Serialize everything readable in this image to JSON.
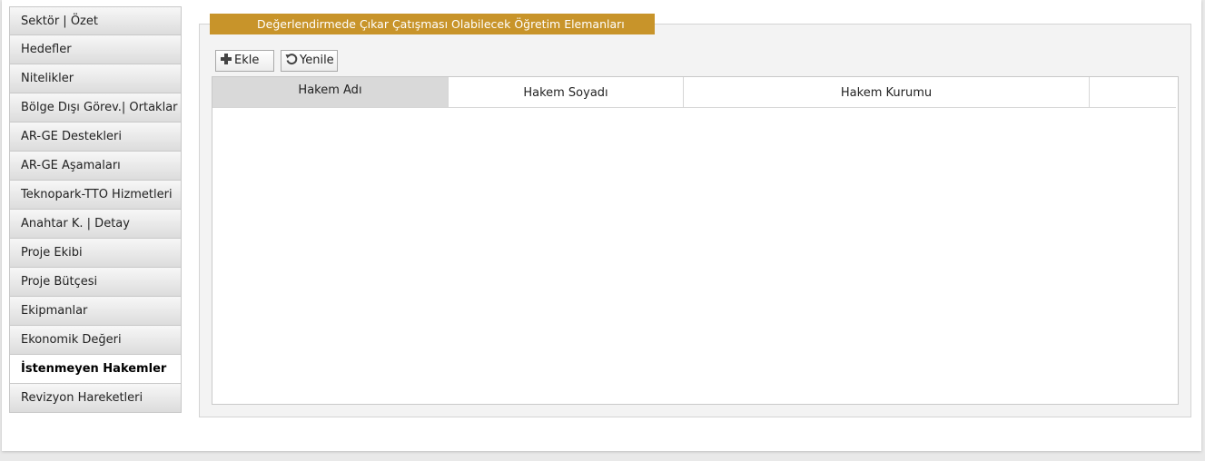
{
  "sidebar": {
    "items": [
      {
        "label": "Sektör | Özet",
        "active": false
      },
      {
        "label": "Hedefler",
        "active": false
      },
      {
        "label": "Nitelikler",
        "active": false
      },
      {
        "label": "Bölge Dışı Görev.| Ortaklar",
        "active": false
      },
      {
        "label": "AR-GE Destekleri",
        "active": false
      },
      {
        "label": "AR-GE Aşamaları",
        "active": false
      },
      {
        "label": "Teknopark-TTO Hizmetleri",
        "active": false
      },
      {
        "label": "Anahtar K. | Detay",
        "active": false
      },
      {
        "label": "Proje Ekibi",
        "active": false
      },
      {
        "label": "Proje Bütçesi",
        "active": false
      },
      {
        "label": "Ekipmanlar",
        "active": false
      },
      {
        "label": "Ekonomik Değeri",
        "active": false
      },
      {
        "label": "İstenmeyen Hakemler",
        "active": true
      },
      {
        "label": "Revizyon Hareketleri",
        "active": false
      }
    ]
  },
  "panel": {
    "title": "Değerlendirmede Çıkar Çatışması Olabilecek Öğretim Elemanları",
    "accent_color": "#c8942a"
  },
  "toolbar": {
    "add_label": "Ekle",
    "add_icon": "plus-icon",
    "refresh_label": "Yenile",
    "refresh_icon": "refresh-icon"
  },
  "grid": {
    "columns": [
      "Hakem Adı",
      "Hakem Soyadı",
      "Hakem Kurumu",
      ""
    ],
    "rows": []
  }
}
